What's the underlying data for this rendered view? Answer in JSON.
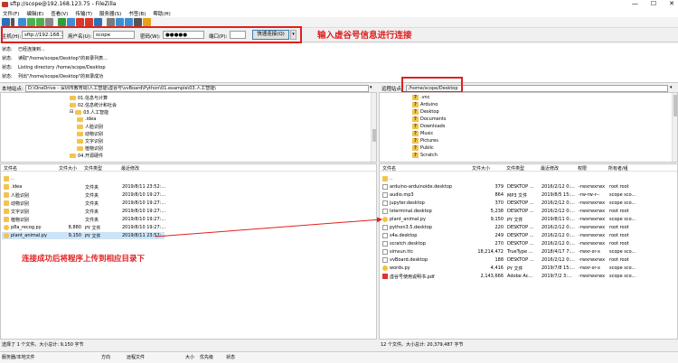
{
  "window": {
    "title": "sftp://scope@192.168.123.75 - FileZilla",
    "controls": [
      "—",
      "☐",
      "✕"
    ]
  },
  "menu": [
    "文件(F)",
    "编辑(E)",
    "查看(V)",
    "传输(T)",
    "服务器(S)",
    "书签(B)",
    "帮助(H)"
  ],
  "toolbar": {
    "icons": [
      "site-manager-icon",
      "dropdown-icon",
      "toggle-log-icon",
      "toggle-tree-local-icon",
      "toggle-tree-remote-icon",
      "toggle-queue-icon",
      "refresh-icon",
      "process-queue-icon",
      "cancel-icon",
      "disconnect-icon",
      "reconnect-icon",
      "filter-icon",
      "compare-icon",
      "sync-browse-icon",
      "search-icon",
      "binoculars-icon"
    ],
    "colors": [
      "#2e6fb7",
      "#555555",
      "#3a8fd4",
      "#4caf50",
      "#4caf50",
      "#888888",
      "#2e9e3e",
      "#3a8fd4",
      "#d33a2c",
      "#d33a2c",
      "#2e6fb7",
      "#7b7b7b",
      "#3a8fd4",
      "#3a8fd4",
      "#555555",
      "#e6a11a"
    ]
  },
  "quickconnect": {
    "host_label": "主机(H):",
    "host_value": "sftp://192.168.123",
    "user_label": "用户名(U):",
    "user_value": "scope",
    "pass_label": "密码(W):",
    "pass_value": "●●●●●",
    "port_label": "端口(P):",
    "port_value": "",
    "button_label": "快速连接(Q)",
    "dropdown_label": "▾"
  },
  "annotations": {
    "top": "输入虚谷号信息进行连接",
    "middle": "连接成功后将程序上传到相应目录下"
  },
  "log": [
    {
      "label": "状态:",
      "text": "已经连接到..."
    },
    {
      "label": "状态:",
      "text": "读取\"/home/scope/Desktop\"的目录列表..."
    },
    {
      "label": "状态:",
      "text": "Listing directory /home/scope/Desktop"
    },
    {
      "label": "状态:",
      "text": "列出\"/home/scope/Desktop\"的目录成功"
    }
  ],
  "local": {
    "path_label": "本地站点:",
    "path_value": "D:\\OneDrive - 深圳市教育局\\人工智能\\虚谷号\\vvBoard\\Python\\01.example\\03.人工智能\\",
    "tree": [
      {
        "label": "01.信息与计算",
        "depth": 0,
        "expander": ""
      },
      {
        "label": "02.信息统计和社会",
        "depth": 0,
        "expander": ""
      },
      {
        "label": "03.人工智能",
        "depth": 0,
        "expander": "⊟"
      },
      {
        "label": ".idea",
        "depth": 1,
        "expander": ""
      },
      {
        "label": "人脸识别",
        "depth": 1,
        "expander": ""
      },
      {
        "label": "动物识别",
        "depth": 1,
        "expander": ""
      },
      {
        "label": "文字识别",
        "depth": 1,
        "expander": ""
      },
      {
        "label": "植物识别",
        "depth": 1,
        "expander": ""
      },
      {
        "label": "04.开源硬件",
        "depth": 0,
        "expander": ""
      }
    ],
    "columns": [
      "文件名",
      "文件大小",
      "文件类型",
      "最近修改"
    ],
    "rows": [
      {
        "name": "..",
        "size": "",
        "type": "",
        "modified": "",
        "icon": "folder"
      },
      {
        "name": ".idea",
        "size": "",
        "type": "文件夹",
        "modified": "2019/8/11 23:52:...",
        "icon": "folder"
      },
      {
        "name": "人脸识别",
        "size": "",
        "type": "文件夹",
        "modified": "2019/8/10 19:27:...",
        "icon": "folder"
      },
      {
        "name": "动物识别",
        "size": "",
        "type": "文件夹",
        "modified": "2019/8/10 19:27:...",
        "icon": "folder"
      },
      {
        "name": "文字识别",
        "size": "",
        "type": "文件夹",
        "modified": "2019/8/10 19:27:...",
        "icon": "folder"
      },
      {
        "name": "植物识别",
        "size": "",
        "type": "文件夹",
        "modified": "2019/8/10 19:27:...",
        "icon": "folder"
      },
      {
        "name": "p8a_recog.py",
        "size": "8,880",
        "type": "PY 文件",
        "modified": "2019/8/10 19:27:...",
        "icon": "py"
      },
      {
        "name": "plant_animal.py",
        "size": "9,150",
        "type": "PY 文件",
        "modified": "2019/8/11 23:52:...",
        "icon": "py",
        "selected": true
      }
    ],
    "status": "选择了 1 个文件。大小总计: 9,150 字节"
  },
  "remote": {
    "path_label": "远程站点:",
    "path_value": "/home/scope/Desktop",
    "tree": [
      {
        "label": ".vnc",
        "depth": 0
      },
      {
        "label": "Arduino",
        "depth": 0
      },
      {
        "label": "Desktop",
        "depth": 0
      },
      {
        "label": "Documents",
        "depth": 0
      },
      {
        "label": "Downloads",
        "depth": 0
      },
      {
        "label": "Music",
        "depth": 0
      },
      {
        "label": "Pictures",
        "depth": 0
      },
      {
        "label": "Public",
        "depth": 0
      },
      {
        "label": "Scratch",
        "depth": 0
      }
    ],
    "columns": [
      "文件名",
      "文件大小",
      "文件类型",
      "最近修改",
      "权限",
      "所有者/组"
    ],
    "rows": [
      {
        "name": "..",
        "size": "",
        "type": "",
        "modified": "",
        "perm": "",
        "owner": "",
        "icon": "folder"
      },
      {
        "name": "arduino-arduinoide.desktop",
        "size": "379",
        "type": "DESKTOP ...",
        "modified": "2016/2/12 0:...",
        "perm": "-rwxrwxrwx",
        "owner": "root root",
        "icon": "file"
      },
      {
        "name": "audio.mp3",
        "size": "864",
        "type": "MP3 文件",
        "modified": "2019/8/5 15:...",
        "perm": "-rw-rw-r--",
        "owner": "scope sco...",
        "icon": "file"
      },
      {
        "name": "jupyter.desktop",
        "size": "370",
        "type": "DESKTOP ...",
        "modified": "2016/2/12 0:...",
        "perm": "-rwxrwxrwx",
        "owner": "scope sco...",
        "icon": "file"
      },
      {
        "name": "lxterminal.desktop",
        "size": "5,238",
        "type": "DESKTOP ...",
        "modified": "2016/2/12 0:...",
        "perm": "-rwxrwxrwx",
        "owner": "root root",
        "icon": "file"
      },
      {
        "name": "plant_animal.py",
        "size": "9,150",
        "type": "PY 文件",
        "modified": "2019/8/11 0:...",
        "perm": "-rwxrwxrwx",
        "owner": "scope sco...",
        "icon": "py"
      },
      {
        "name": "python3.5.desktop",
        "size": "220",
        "type": "DESKTOP ...",
        "modified": "2016/2/12 0:...",
        "perm": "-rwxrwxrwx",
        "owner": "root root",
        "icon": "file"
      },
      {
        "name": "s4a.desktop",
        "size": "249",
        "type": "DESKTOP ...",
        "modified": "2016/2/12 0:...",
        "perm": "-rwxrwxrwx",
        "owner": "root root",
        "icon": "file"
      },
      {
        "name": "scratch.desktop",
        "size": "270",
        "type": "DESKTOP ...",
        "modified": "2016/2/12 0:...",
        "perm": "-rwxrwxrwx",
        "owner": "root root",
        "icon": "file"
      },
      {
        "name": "simsun.ttc",
        "size": "18,214,472",
        "type": "TrueType ...",
        "modified": "2018/4/17 7:...",
        "perm": "-rwxr-xr-x",
        "owner": "scope sco...",
        "icon": "file"
      },
      {
        "name": "vvBoard.desktop",
        "size": "188",
        "type": "DESKTOP ...",
        "modified": "2016/2/12 0:...",
        "perm": "-rwxrwxrwx",
        "owner": "root root",
        "icon": "file"
      },
      {
        "name": "words.py",
        "size": "4,416",
        "type": "PY 文件",
        "modified": "2019/7/8 15:...",
        "perm": "-rwxr-xr-x",
        "owner": "scope sco...",
        "icon": "py"
      },
      {
        "name": "虚谷号使用说明书.pdf",
        "size": "2,143,666",
        "type": "Adobe Ac...",
        "modified": "2019/7/2 3:...",
        "perm": "-rwxrwxrwx",
        "owner": "scope sco...",
        "icon": "pdf"
      }
    ],
    "status": "12 个文件。大小总计: 20,379,487 字节"
  },
  "queue": {
    "columns": [
      "服务器/本地文件",
      "方向",
      "远程文件",
      "大小",
      "优先级",
      "状态"
    ]
  }
}
